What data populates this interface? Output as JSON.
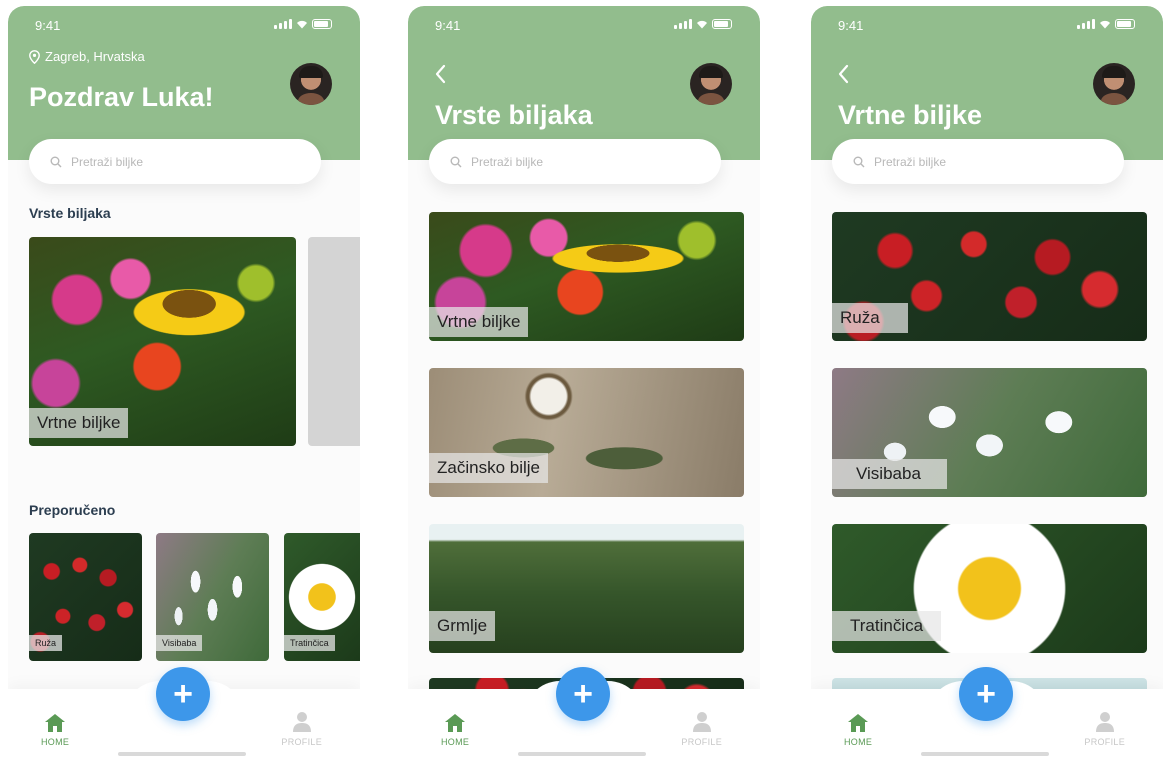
{
  "status": {
    "time": "9:41"
  },
  "screen1": {
    "location": "Zagreb, Hrvatska",
    "greeting": "Pozdrav Luka!",
    "search_placeholder": "Pretraži biljke",
    "section_types": "Vrste biljaka",
    "featured_card": "Vrtne biljke",
    "section_recommended": "Preporučeno",
    "recommended": [
      "Ruža",
      "Visibaba",
      "Tratinčica"
    ]
  },
  "screen2": {
    "title": "Vrste biljaka",
    "search_placeholder": "Pretraži biljke",
    "cards": [
      "Vrtne biljke",
      "Začinsko bilje",
      "Grmlje"
    ]
  },
  "screen3": {
    "title": "Vrtne biljke",
    "search_placeholder": "Pretraži biljke",
    "cards": [
      "Ruža",
      "Visibaba",
      "Tratinčica"
    ]
  },
  "nav": {
    "home": "HOME",
    "profile": "PROFILE",
    "fab": "+"
  },
  "colors": {
    "header": "#92bd8d",
    "fab": "#3d97ea",
    "nav_active": "#5a9a55"
  }
}
